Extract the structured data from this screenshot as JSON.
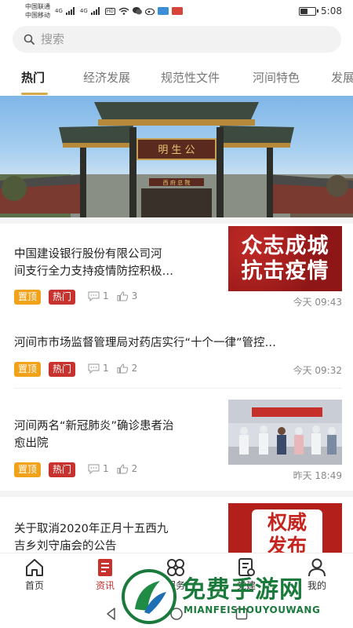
{
  "status_bar": {
    "carrier1": "中国联通",
    "carrier2": "中国移动",
    "network1": "4G",
    "network2": "4G",
    "hd": "HD",
    "time": "5:08",
    "battery_level": 0.55
  },
  "search": {
    "placeholder": "搜索"
  },
  "tabs": [
    {
      "label": "热门",
      "active": true
    },
    {
      "label": "经济发展",
      "active": false
    },
    {
      "label": "规范性文件",
      "active": false
    },
    {
      "label": "河间特色",
      "active": false
    },
    {
      "label": "发展",
      "active": false
    }
  ],
  "banner": {
    "plaque_text": "明 生 公",
    "sub_plaque_text": "西 府 总 院"
  },
  "news": [
    {
      "title_line1": "中国建设银行股份有限公司河",
      "title_line2": "间支行全力支持疫情防控积极…",
      "tag_top": "置顶",
      "tag_hot": "热门",
      "comments": "1",
      "likes": "3",
      "time": "今天 09:43",
      "thumb_line1": "众志成城",
      "thumb_line2": "抗击疫情"
    },
    {
      "title_line1": "河间市市场监督管理局对药店实行“十个一律”管控…",
      "tag_top": "置顶",
      "tag_hot": "热门",
      "comments": "1",
      "likes": "2",
      "time": "今天 09:32"
    },
    {
      "title_line1": "河间两名“新冠肺炎”确诊患者治",
      "title_line2": "愈出院",
      "tag_top": "置顶",
      "tag_hot": "热门",
      "comments": "1",
      "likes": "2",
      "time": "昨天 18:49"
    },
    {
      "title_line1": "关于取消2020年正月十五西九",
      "title_line2": "吉乡刘守庙会的公告",
      "thumb_line1": "权威",
      "thumb_line2": "发布"
    }
  ],
  "bottom_nav": [
    {
      "label": "首页",
      "icon": "home-icon"
    },
    {
      "label": "资讯",
      "icon": "news-icon",
      "active": true
    },
    {
      "label": "服务",
      "icon": "service-icon"
    },
    {
      "label": "党建",
      "icon": "party-icon"
    },
    {
      "label": "我的",
      "icon": "user-icon"
    }
  ],
  "watermark": {
    "title": "免费手游网",
    "subtitle": "MIANFEISHOUYOUWANG"
  },
  "colors": {
    "accent_gold": "#d4a94a",
    "tag_top": "#f0a21b",
    "tag_hot": "#c8322e",
    "watermark_green": "#1a7a3b"
  }
}
